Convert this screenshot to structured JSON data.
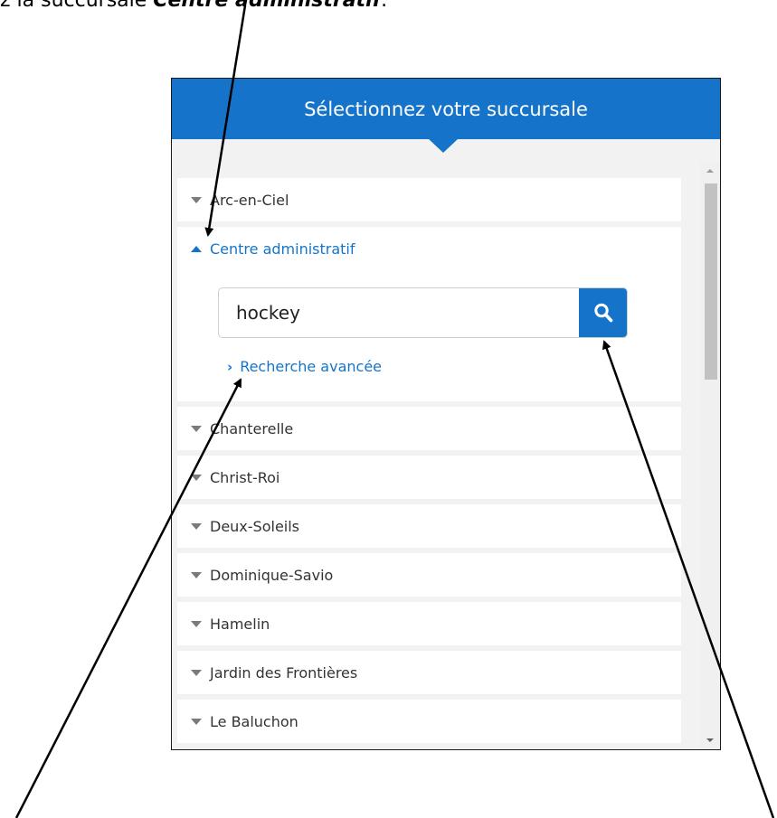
{
  "caption": {
    "prefix": "z la succursale ",
    "emphasis": "Centre administratif",
    "suffix": "."
  },
  "panel": {
    "title": "Sélectionnez votre succursale"
  },
  "branches": {
    "first": "Arc-en-Ciel",
    "expanded": "Centre administratif",
    "rest": [
      "Chanterelle",
      "Christ-Roi",
      "Deux-Soleils",
      "Dominique-Savio",
      "Hamelin",
      "Jardin des Frontières",
      "Le Baluchon"
    ]
  },
  "search": {
    "value": "hockey",
    "advanced_label": "Recherche avancée",
    "icon": "search-icon"
  },
  "colors": {
    "brand_blue": "#1574c9",
    "panel_bg": "#f2f2f2",
    "item_text": "#333333"
  },
  "icons": {
    "collapsed": "caret-down-icon",
    "expanded": "caret-up-icon",
    "advanced": "chevron-right-icon"
  }
}
